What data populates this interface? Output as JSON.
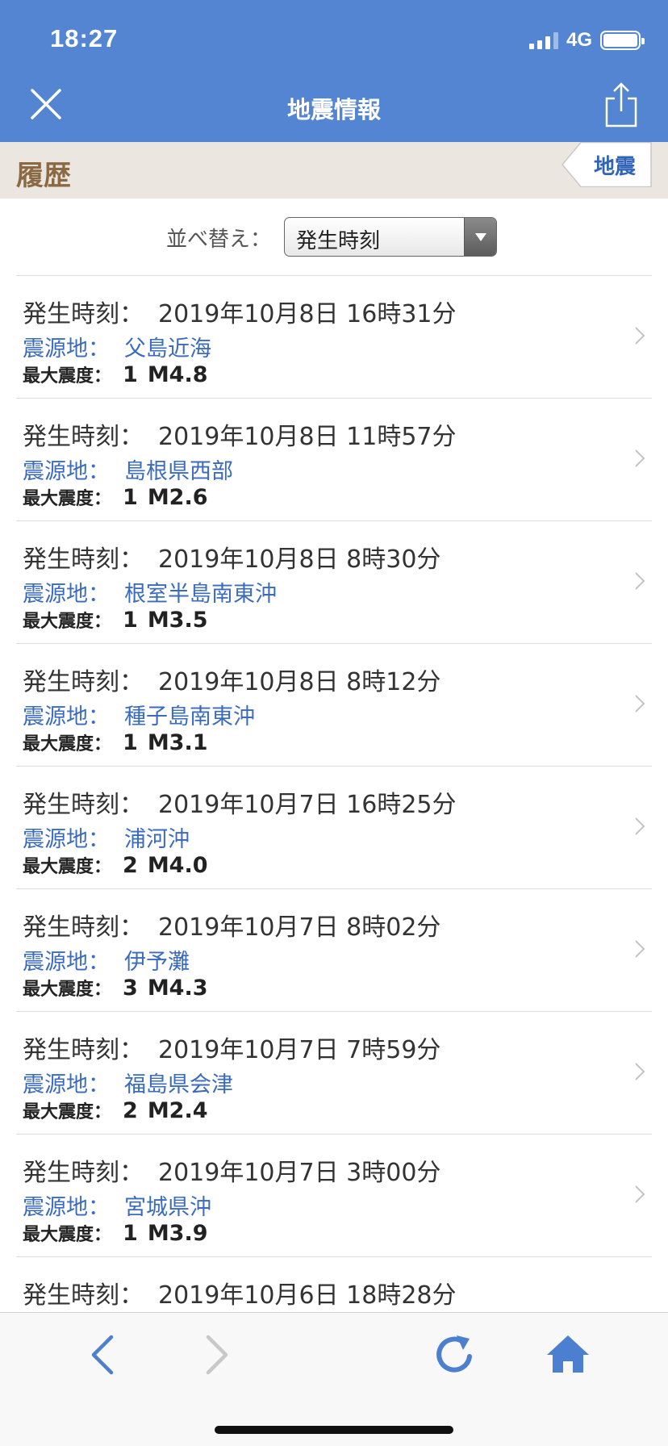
{
  "status_bar": {
    "time": "18:27",
    "network": "4G"
  },
  "nav": {
    "title": "地震情報"
  },
  "section": {
    "title": "履歴",
    "tag_button": "地震"
  },
  "sort": {
    "label": "並べ替え：",
    "selected": "発生時刻"
  },
  "labels": {
    "time": "発生時刻：",
    "epicenter": "震源地：",
    "intensity": "最大震度："
  },
  "earthquakes": [
    {
      "time": "2019年10月8日 16時31分",
      "epicenter": "父島近海",
      "intensity": "1",
      "magnitude": "M4.8"
    },
    {
      "time": "2019年10月8日 11時57分",
      "epicenter": "島根県西部",
      "intensity": "1",
      "magnitude": "M2.6"
    },
    {
      "time": "2019年10月8日 8時30分",
      "epicenter": "根室半島南東沖",
      "intensity": "1",
      "magnitude": "M3.5"
    },
    {
      "time": "2019年10月8日 8時12分",
      "epicenter": "種子島南東沖",
      "intensity": "1",
      "magnitude": "M3.1"
    },
    {
      "time": "2019年10月7日 16時25分",
      "epicenter": "浦河沖",
      "intensity": "2",
      "magnitude": "M4.0"
    },
    {
      "time": "2019年10月7日 8時02分",
      "epicenter": "伊予灘",
      "intensity": "3",
      "magnitude": "M4.3"
    },
    {
      "time": "2019年10月7日 7時59分",
      "epicenter": "福島県会津",
      "intensity": "2",
      "magnitude": "M2.4"
    },
    {
      "time": "2019年10月7日 3時00分",
      "epicenter": "宮城県沖",
      "intensity": "1",
      "magnitude": "M3.9"
    },
    {
      "time": "2019年10月6日 18時28分"
    }
  ],
  "colors": {
    "header_blue": "#5385d2",
    "link_blue": "#3a6bbf",
    "section_brown": "#8a6a45"
  }
}
